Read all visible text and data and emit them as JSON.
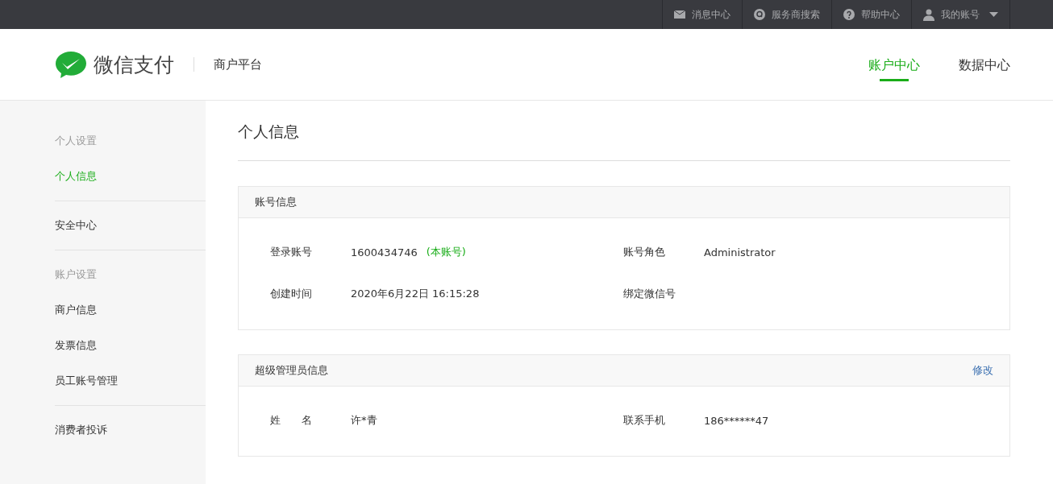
{
  "top_nav": [
    {
      "kind": "mail",
      "label": "消息中心"
    },
    {
      "kind": "search",
      "label": "服务商搜索"
    },
    {
      "kind": "help",
      "label": "帮助中心"
    },
    {
      "kind": "user",
      "label": "我的账号"
    }
  ],
  "header": {
    "logo_text": "微信支付",
    "platform": "商户平台",
    "tabs": [
      {
        "label": "账户中心",
        "selected": true
      },
      {
        "label": "数据中心",
        "selected": false
      }
    ]
  },
  "sidebar": {
    "sections": [
      {
        "heading": "个人设置",
        "items": [
          {
            "label": "个人信息",
            "selected": true
          }
        ]
      },
      {
        "items": [
          {
            "label": "安全中心",
            "selected": false
          }
        ]
      },
      {
        "heading": "账户设置",
        "items": [
          {
            "label": "商户信息",
            "selected": false
          },
          {
            "label": "发票信息",
            "selected": false
          },
          {
            "label": "员工账号管理",
            "selected": false
          }
        ]
      },
      {
        "items": [
          {
            "label": "消费者投诉",
            "selected": false
          }
        ]
      }
    ]
  },
  "page_title": "个人信息",
  "panels": [
    {
      "title": "账号信息",
      "rows": [
        [
          {
            "label": "登录账号",
            "value": "1600434746",
            "note": "(本账号)"
          },
          {
            "label": "账号角色",
            "value": "Administrator"
          }
        ],
        [
          {
            "label": "创建时间",
            "value": "2020年6月22日 16:15:28"
          },
          {
            "label": "绑定微信号"
          }
        ]
      ]
    },
    {
      "title": "超级管理员信息",
      "action": "修改",
      "rows": [
        [
          {
            "label": "姓　　名",
            "value": "许*青"
          },
          {
            "label": "联系手机",
            "value": "186******47"
          }
        ]
      ]
    }
  ]
}
